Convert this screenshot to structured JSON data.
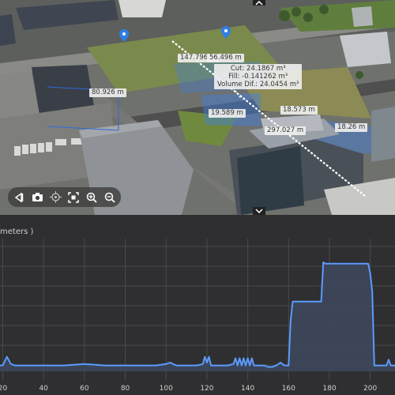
{
  "viewport": {
    "measurements": {
      "m1": "147.796 m",
      "m2": "56.496 m",
      "m3": "80.926 m",
      "m4": "19.589 m",
      "m5": "18.573 m",
      "m6": "297.027 m",
      "m7": "18.26 m"
    },
    "volume": {
      "cut": "Cut: 24.1867 m³",
      "fill": "Fill: -0.141262 m³",
      "diff": "Volume Dif.: 24.0454 m³"
    },
    "toolbar": [
      "back-icon",
      "camera-icon",
      "target-icon",
      "fit-screen-icon",
      "zoom-in-icon",
      "zoom-out-icon"
    ],
    "colors": {
      "measure_line": "#ffffff",
      "highlight": "#3f7fe0",
      "pin": "#2f7ee6"
    }
  },
  "profile": {
    "title": "meters )",
    "x_ticks": [
      "20",
      "40",
      "60",
      "80",
      "100",
      "120",
      "140",
      "160",
      "180",
      "200"
    ],
    "colors": {
      "line": "#5b9bff",
      "fill": "#3c475a",
      "grid": "#4a4a4c",
      "background": "#2f2f31"
    }
  },
  "chart_data": {
    "type": "area",
    "xlabel": "",
    "ylabel": "",
    "xlim": [
      14,
      216
    ],
    "ylim": [
      0,
      100
    ],
    "grid": true,
    "x": [
      14,
      20,
      22,
      24,
      26,
      30,
      40,
      50,
      60,
      70,
      80,
      90,
      95,
      100,
      102,
      105,
      110,
      115,
      118,
      119,
      120,
      121,
      122,
      125,
      130,
      133,
      134,
      135,
      136,
      137,
      138,
      139,
      140,
      141,
      142,
      143,
      144,
      145,
      146,
      148,
      150,
      152,
      154,
      156,
      158,
      159,
      160,
      161,
      162,
      163,
      164,
      166,
      168,
      170,
      172,
      174,
      176,
      177,
      178,
      180,
      182,
      184,
      186,
      188,
      190,
      192,
      194,
      196,
      198,
      199,
      200,
      201,
      202,
      204,
      206,
      208,
      209,
      210,
      212,
      214,
      216
    ],
    "values": [
      4,
      4,
      10,
      5,
      4,
      4,
      4,
      4,
      5,
      4,
      4,
      4,
      4,
      5,
      6,
      4,
      4,
      4,
      5,
      10,
      6,
      10,
      4,
      4,
      4,
      5,
      9,
      4,
      9,
      4,
      9,
      4,
      9,
      4,
      9,
      4,
      4,
      4,
      4,
      4,
      3,
      3,
      4,
      6,
      4,
      4,
      4,
      35,
      48,
      48,
      48,
      48,
      48,
      48,
      48,
      48,
      48,
      75,
      74,
      74,
      74,
      74,
      74,
      74,
      74,
      74,
      74,
      74,
      74,
      74,
      67,
      55,
      4,
      4,
      4,
      4,
      8,
      4,
      4,
      4,
      4
    ]
  }
}
